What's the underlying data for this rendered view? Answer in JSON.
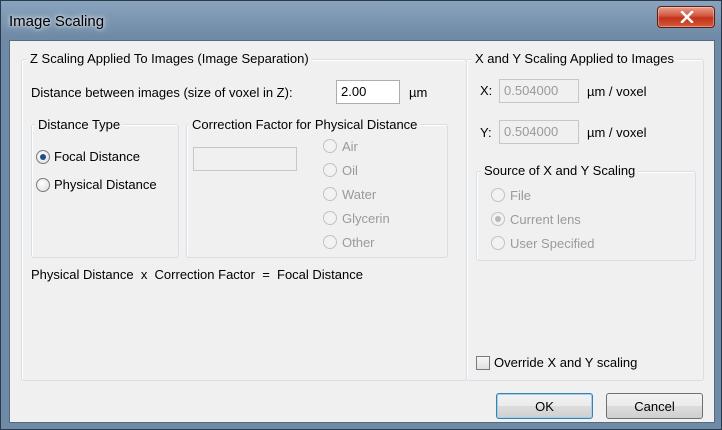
{
  "window": {
    "title": "Image Scaling"
  },
  "z_group": {
    "caption": "Z Scaling Applied To Images (Image Separation)",
    "distance_label": "Distance between images (size of voxel in Z):",
    "distance_value": "2.00",
    "distance_unit": "µm",
    "distance_type": {
      "caption": "Distance Type",
      "options": [
        "Focal Distance",
        "Physical Distance"
      ],
      "selected": "Focal Distance"
    },
    "correction": {
      "caption": "Correction Factor for Physical Distance",
      "value": "",
      "options": [
        "Air",
        "Oil",
        "Water",
        "Glycerin",
        "Other"
      ]
    },
    "formula": "Physical Distance  x  Correction Factor  =  Focal Distance"
  },
  "xy_group": {
    "caption": "X and Y Scaling Applied to Images",
    "x_label": "X:",
    "x_value": "0.504000",
    "x_unit": "µm / voxel",
    "y_label": "Y:",
    "y_value": "0.504000",
    "y_unit": "µm / voxel",
    "source": {
      "caption": "Source of X and Y Scaling",
      "options": [
        "File",
        "Current lens",
        "User Specified"
      ],
      "selected": "Current lens"
    },
    "override_label": "Override X and Y scaling",
    "override_checked": false
  },
  "buttons": {
    "ok": "OK",
    "cancel": "Cancel"
  }
}
